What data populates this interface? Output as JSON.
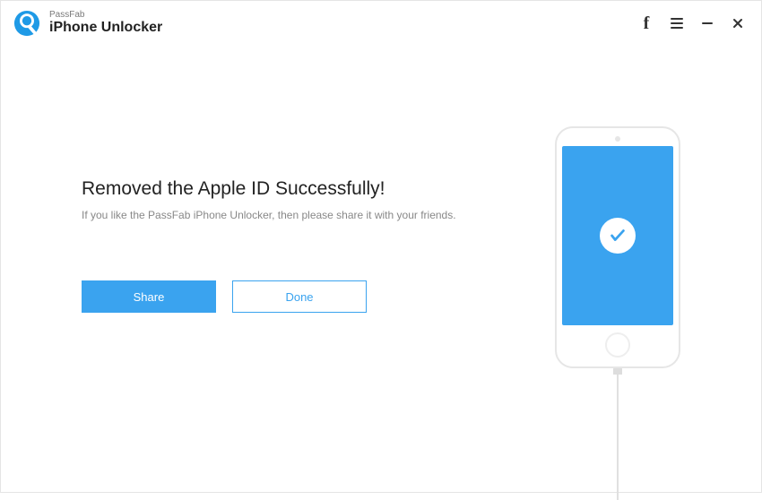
{
  "brand": {
    "supertitle": "PassFab",
    "title": "iPhone Unlocker"
  },
  "main": {
    "headline": "Removed the Apple ID Successfully!",
    "subtext": "If you like the PassFab iPhone Unlocker, then please share it with your friends.",
    "share_label": "Share",
    "done_label": "Done"
  },
  "colors": {
    "accent": "#3aa3ef"
  }
}
